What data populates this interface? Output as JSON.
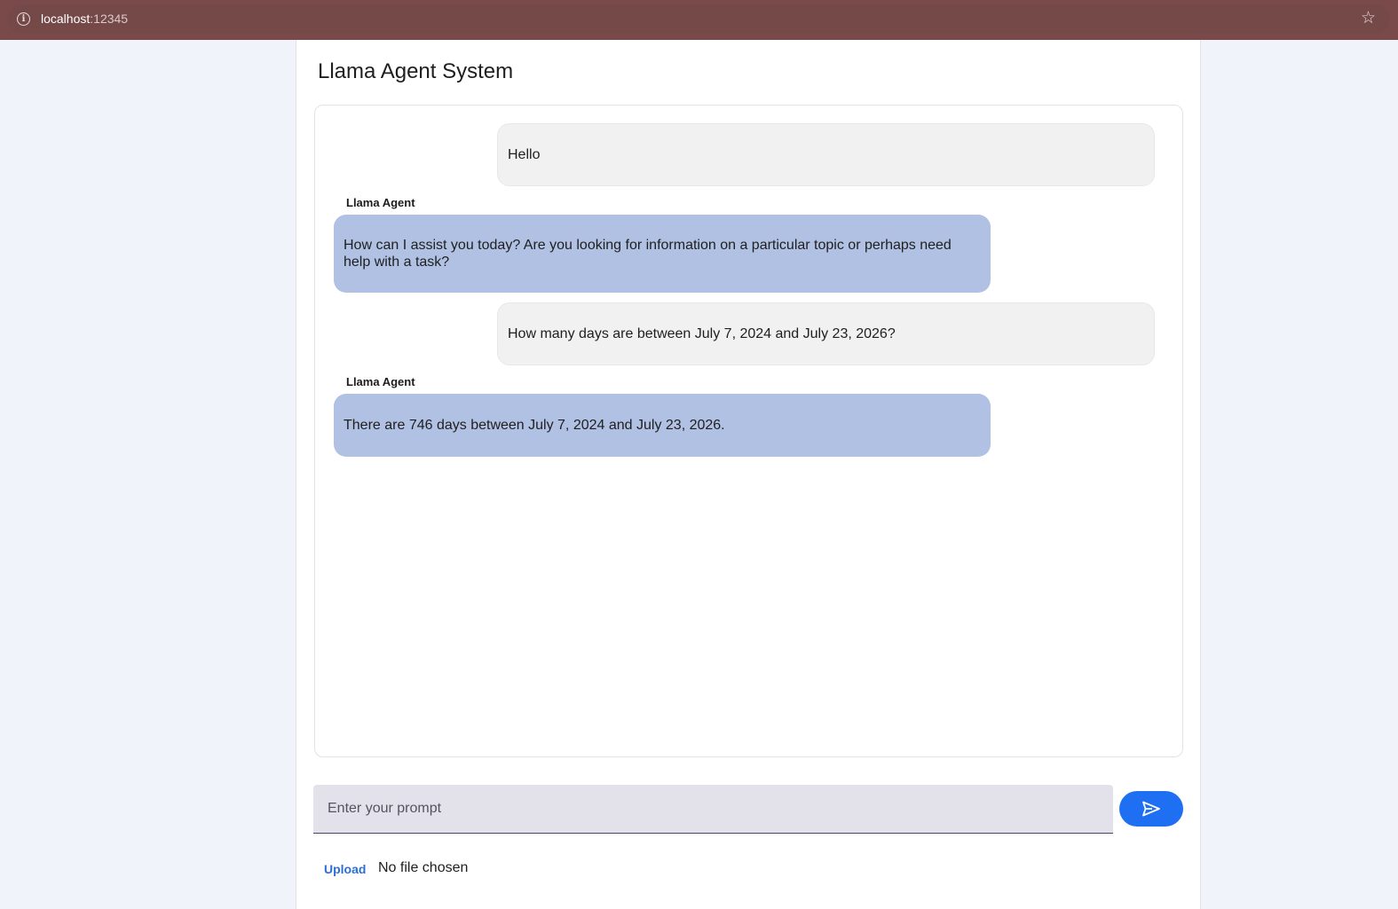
{
  "browser": {
    "url_host": "localhost",
    "url_port": ":12345"
  },
  "app": {
    "title": "Llama Agent System"
  },
  "messages": [
    {
      "role": "user",
      "text": "Hello"
    },
    {
      "role": "agent",
      "sender": "Llama Agent",
      "text": "How can I assist you today? Are you looking for information on a particular topic or perhaps need help with a task?"
    },
    {
      "role": "user",
      "text": "How many days are between July 7, 2024 and July 23, 2026?"
    },
    {
      "role": "agent",
      "sender": "Llama Agent",
      "text": "There are 746 days between July 7, 2024 and July 23, 2026."
    }
  ],
  "input": {
    "placeholder": "Enter your prompt",
    "value": ""
  },
  "send_icon": "send-icon",
  "upload": {
    "label": "Upload",
    "status": "No file chosen"
  }
}
